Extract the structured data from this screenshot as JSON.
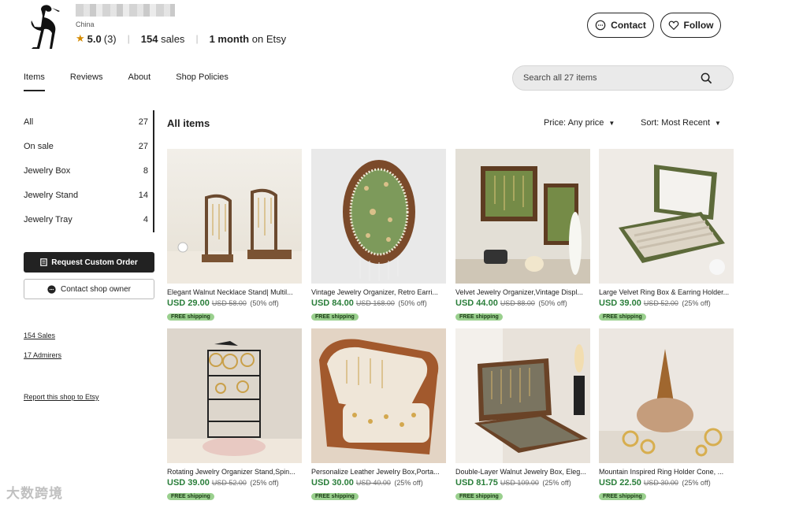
{
  "shop": {
    "location": "China",
    "rating": "5.0",
    "review_count": "(3)",
    "sales_num": "154",
    "sales_label": "sales",
    "tenure_num": "1 month",
    "tenure_label": "on Etsy"
  },
  "header": {
    "contact_label": "Contact",
    "follow_label": "Follow"
  },
  "tabs": [
    {
      "label": "Items"
    },
    {
      "label": "Reviews"
    },
    {
      "label": "About"
    },
    {
      "label": "Shop Policies"
    }
  ],
  "search": {
    "placeholder": "Search all 27 items"
  },
  "sidebar": {
    "categories": [
      {
        "label": "All",
        "count": "27"
      },
      {
        "label": "On sale",
        "count": "27"
      },
      {
        "label": "Jewelry Box",
        "count": "8"
      },
      {
        "label": "Jewelry Stand",
        "count": "14"
      },
      {
        "label": "Jewelry Tray",
        "count": "4"
      }
    ],
    "request_label": "Request Custom Order",
    "owner_label": "Contact shop owner",
    "sales_link": "154 Sales",
    "admirers_link": "17 Admirers",
    "report_link": "Report this shop to Etsy"
  },
  "main": {
    "title": "All items",
    "price_filter": "Price: Any price",
    "sort_filter": "Sort: Most Recent"
  },
  "badge_label": "FREE shipping",
  "products": [
    {
      "title": "Elegant Walnut Necklace Stand| Multil...",
      "price": "USD 29.00",
      "orig": "USD 58.00",
      "disc": "(50% off)"
    },
    {
      "title": "Vintage Jewelry Organizer, Retro Earri...",
      "price": "USD 84.00",
      "orig": "USD 168.00",
      "disc": "(50% off)"
    },
    {
      "title": "Velvet Jewelry Organizer,Vintage Displ...",
      "price": "USD 44.00",
      "orig": "USD 88.00",
      "disc": "(50% off)"
    },
    {
      "title": "Large Velvet Ring Box & Earring Holder...",
      "price": "USD 39.00",
      "orig": "USD 52.00",
      "disc": "(25% off)"
    },
    {
      "title": "Rotating Jewelry Organizer Stand,Spin...",
      "price": "USD 39.00",
      "orig": "USD 52.00",
      "disc": "(25% off)"
    },
    {
      "title": "Personalize Leather Jewelry Box,Porta...",
      "price": "USD 30.00",
      "orig": "USD 40.00",
      "disc": "(25% off)"
    },
    {
      "title": "Double-Layer Walnut Jewelry Box, Eleg...",
      "price": "USD 81.75",
      "orig": "USD 109.00",
      "disc": "(25% off)"
    },
    {
      "title": "Mountain Inspired Ring Holder Cone, ...",
      "price": "USD 22.50",
      "orig": "USD 30.00",
      "disc": "(25% off)"
    }
  ],
  "watermark": "大数跨境",
  "colors": {
    "price_green": "#2a7e3a",
    "badge_green": "#9ad08e",
    "star": "#d58b00"
  }
}
